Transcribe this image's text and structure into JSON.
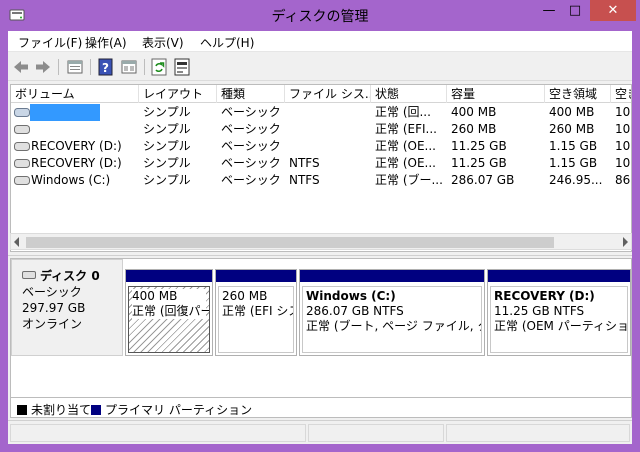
{
  "window": {
    "title": "ディスクの管理"
  },
  "menu": [
    "ファイル(F)",
    "操作(A)",
    "表示(V)",
    "ヘルプ(H)"
  ],
  "toolbar": {
    "icons": [
      "back-arrow-icon",
      "forward-arrow-icon",
      "properties-pane-icon",
      "help-icon",
      "console-view-icon",
      "refresh-icon",
      "rescan-disks-icon"
    ]
  },
  "volume_list": {
    "columns": [
      "ボリューム",
      "レイアウト",
      "種類",
      "ファイル シス...",
      "状態",
      "容量",
      "空き領域",
      "空き"
    ],
    "rows": [
      {
        "volume": "",
        "layout": "シンプル",
        "type": "ベーシック",
        "fs": "",
        "status": "正常 (回...",
        "capacity": "400 MB",
        "free": "400 MB",
        "pct": "10"
      },
      {
        "volume": "",
        "layout": "シンプル",
        "type": "ベーシック",
        "fs": "",
        "status": "正常 (EFI...",
        "capacity": "260 MB",
        "free": "260 MB",
        "pct": "10"
      },
      {
        "volume": "RECOVERY (D:)",
        "layout": "シンプル",
        "type": "ベーシック",
        "fs": "",
        "status": "正常 (OE...",
        "capacity": "11.25 GB",
        "free": "1.15 GB",
        "pct": "10"
      },
      {
        "volume": "RECOVERY (D:)",
        "layout": "シンプル",
        "type": "ベーシック",
        "fs": "NTFS",
        "status": "正常 (OE...",
        "capacity": "11.25 GB",
        "free": "1.15 GB",
        "pct": "10"
      },
      {
        "volume": "Windows (C:)",
        "layout": "シンプル",
        "type": "ベーシック",
        "fs": "NTFS",
        "status": "正常 (ブー...",
        "capacity": "286.07 GB",
        "free": "246.95...",
        "pct": "86"
      }
    ]
  },
  "disk": {
    "name": "ディスク 0",
    "type": "ベーシック",
    "size": "297.97 GB",
    "state": "オンライン",
    "partitions": [
      {
        "title": "",
        "line1": "400 MB",
        "line2": "正常 (回復パーティション)"
      },
      {
        "title": "",
        "line1": "260 MB",
        "line2": "正常 (EFI システム パーティション)"
      },
      {
        "title": "Windows  (C:)",
        "line1": "286.07 GB NTFS",
        "line2": "正常 (ブート, ページ ファイル, クラッシュ ダンプ, プライマリ パーティション)"
      },
      {
        "title": "RECOVERY  (D:)",
        "line1": "11.25 GB NTFS",
        "line2": "正常 (OEM パーティション)"
      }
    ]
  },
  "legend": [
    {
      "label": "未割り当て",
      "color": "#000000"
    },
    {
      "label": "プライマリ パーティション",
      "color": "#000080"
    }
  ],
  "colors": {
    "accent": "#a465cc",
    "close": "#c7504f",
    "partition_bar": "#000080",
    "selection": "#3399ff"
  }
}
